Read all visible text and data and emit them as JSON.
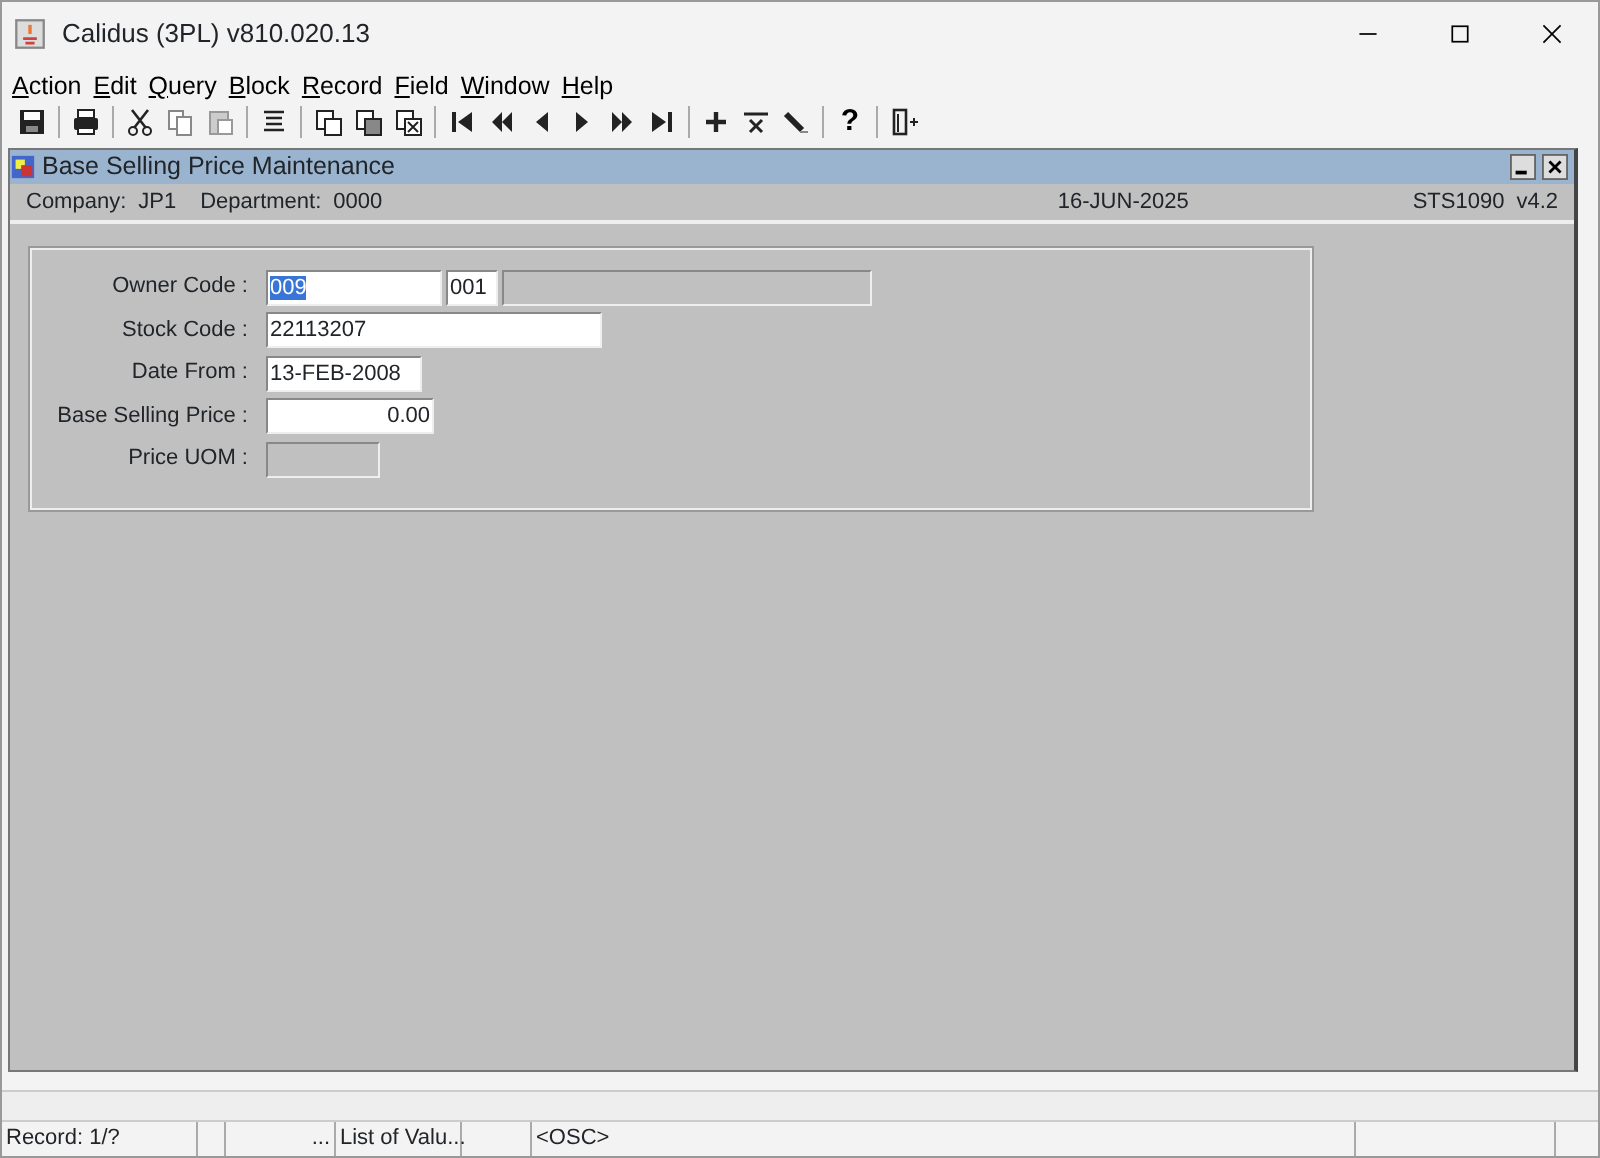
{
  "window": {
    "title": "Calidus (3PL) v810.020.13"
  },
  "menu": [
    "Action",
    "Edit",
    "Query",
    "Block",
    "Record",
    "Field",
    "Window",
    "Help"
  ],
  "toolbar": {
    "help_glyph": "?"
  },
  "form_window": {
    "title": "Base Selling Price Maintenance"
  },
  "header": {
    "company_label": "Company:",
    "company": "JP1",
    "department_label": "Department:",
    "department": "0000",
    "date": "16-JUN-2025",
    "screen_code": "STS1090",
    "version": "v4.2"
  },
  "fields": [
    {
      "label": "Owner Code :",
      "inputs": [
        {
          "value": "009",
          "selected": true,
          "disabled": false
        },
        {
          "value": "001",
          "selected": false,
          "disabled": false
        },
        {
          "disabled": true
        }
      ]
    },
    {
      "label": "Stock Code :",
      "inputs": [
        {
          "value": "22113207",
          "selected": false,
          "disabled": false
        }
      ]
    },
    {
      "label": "Date From :",
      "inputs": [
        {
          "value": "13-FEB-2008",
          "selected": false,
          "disabled": false
        }
      ]
    },
    {
      "label": "Base Selling Price :",
      "inputs": [
        {
          "value": "0.00",
          "selected": false,
          "disabled": false,
          "kind": "number"
        }
      ]
    },
    {
      "label": "Price UOM :",
      "inputs": [
        {
          "disabled": true
        }
      ]
    }
  ],
  "status_bar": {
    "record": "Record: 1/?",
    "lov_button": "...",
    "lov_label": "List of Valu...",
    "mode": "<OSC>"
  }
}
